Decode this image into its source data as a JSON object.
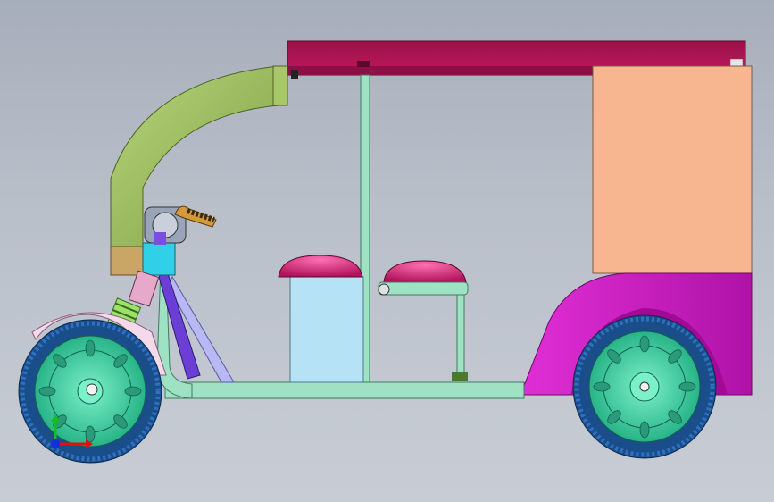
{
  "viewport": {
    "background": "#b9bfc9"
  },
  "model": {
    "canopy_roof": {
      "color": "#b0155a"
    },
    "rear_panel": {
      "color": "#f7b68f"
    },
    "front_arch": {
      "color": "#9bbd5c"
    },
    "frame": {
      "color": "#9fe2c3"
    },
    "rear_body": {
      "color": "#d21ec8"
    },
    "seats": {
      "color": "#c81a6e"
    },
    "battery_box": {
      "color": "#b5e3f5"
    },
    "steering_head": {
      "color": "#2fd0e8"
    },
    "wheels": {
      "tire": "#1a4e8a",
      "hub": "#3fd6a6"
    }
  },
  "triad": {
    "x_axis_color": "#e01010",
    "y_axis_color": "#10c020",
    "z_axis_color": "#1030e0"
  }
}
